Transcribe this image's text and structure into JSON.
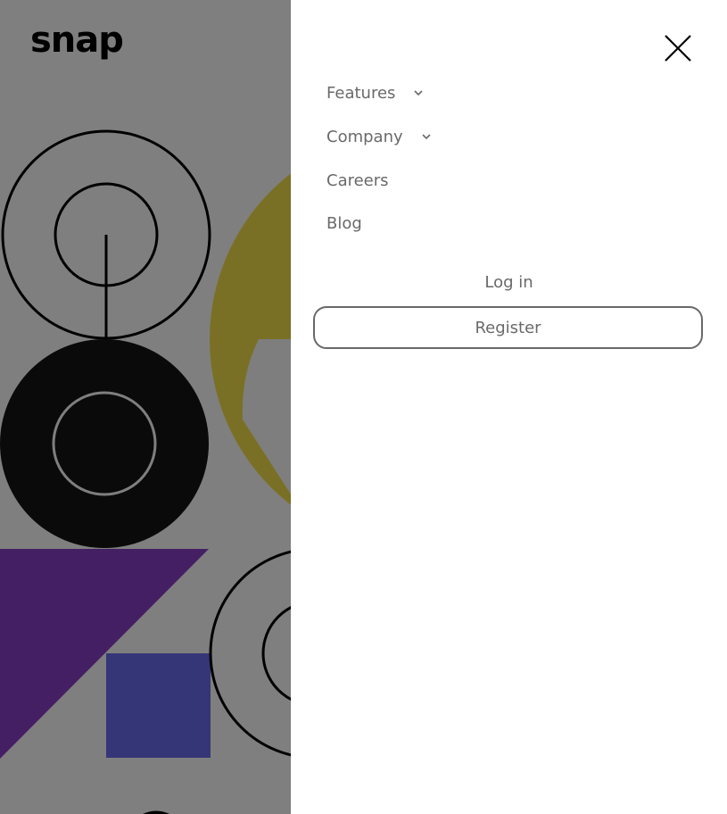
{
  "brand": {
    "logo_text": "snap"
  },
  "menu": {
    "close_icon": "close-icon",
    "items": [
      {
        "label": "Features",
        "has_dropdown": true,
        "icon": "chevron-down-icon"
      },
      {
        "label": "Company",
        "has_dropdown": true,
        "icon": "chevron-down-icon"
      },
      {
        "label": "Careers",
        "has_dropdown": false
      },
      {
        "label": "Blog",
        "has_dropdown": false
      }
    ],
    "login_label": "Log in",
    "register_label": "Register"
  },
  "colors": {
    "text_gray": "#696969",
    "overlay": "rgba(0,0,0,0.5)",
    "hero_yellow": "#f5e04a",
    "hero_purple": "#8b3ec8",
    "hero_blue": "#6b6cf0"
  }
}
